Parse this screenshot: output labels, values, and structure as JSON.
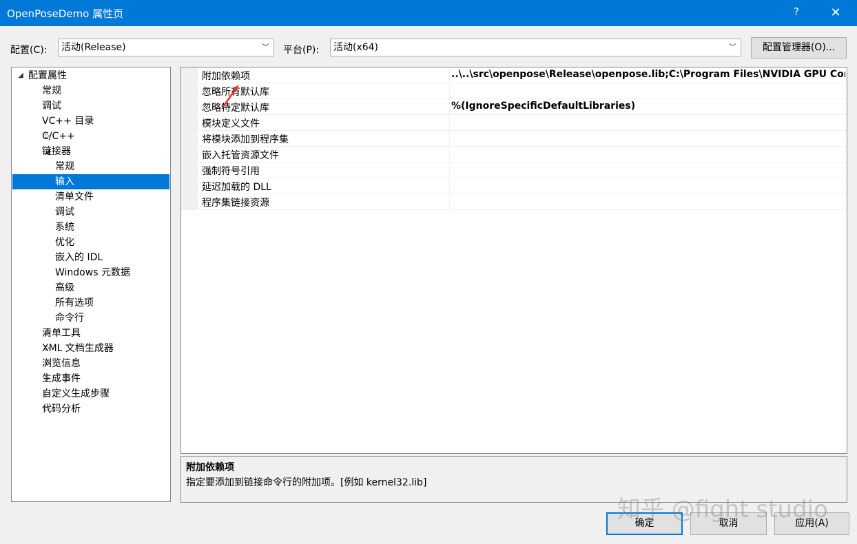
{
  "window": {
    "title": "OpenPoseDemo 属性页",
    "help_label": "?",
    "close_label": "✕"
  },
  "config_bar": {
    "config_label": "配置(C):",
    "config_value": "活动(Release)",
    "platform_label": "平台(P):",
    "platform_value": "活动(x64)",
    "manager_button": "配置管理器(O)..."
  },
  "tree": {
    "items": [
      {
        "label": "配置属性",
        "expander": "◢",
        "level": 0,
        "selected": false
      },
      {
        "label": "常规",
        "expander": "",
        "level": 1,
        "selected": false
      },
      {
        "label": "调试",
        "expander": "",
        "level": 1,
        "selected": false
      },
      {
        "label": "VC++ 目录",
        "expander": "",
        "level": 1,
        "selected": false
      },
      {
        "label": "C/C++",
        "expander": "▷",
        "level": 1,
        "selected": false
      },
      {
        "label": "链接器",
        "expander": "◢",
        "level": 1,
        "selected": false
      },
      {
        "label": "常规",
        "expander": "",
        "level": 2,
        "selected": false
      },
      {
        "label": "输入",
        "expander": "",
        "level": 2,
        "selected": true
      },
      {
        "label": "清单文件",
        "expander": "",
        "level": 2,
        "selected": false
      },
      {
        "label": "调试",
        "expander": "",
        "level": 2,
        "selected": false
      },
      {
        "label": "系统",
        "expander": "",
        "level": 2,
        "selected": false
      },
      {
        "label": "优化",
        "expander": "",
        "level": 2,
        "selected": false
      },
      {
        "label": "嵌入的 IDL",
        "expander": "",
        "level": 2,
        "selected": false
      },
      {
        "label": "Windows 元数据",
        "expander": "",
        "level": 2,
        "selected": false
      },
      {
        "label": "高级",
        "expander": "",
        "level": 2,
        "selected": false
      },
      {
        "label": "所有选项",
        "expander": "",
        "level": 2,
        "selected": false
      },
      {
        "label": "命令行",
        "expander": "",
        "level": 2,
        "selected": false
      },
      {
        "label": "清单工具",
        "expander": "▷",
        "level": 1,
        "selected": false
      },
      {
        "label": "XML 文档生成器",
        "expander": "▷",
        "level": 1,
        "selected": false
      },
      {
        "label": "浏览信息",
        "expander": "▷",
        "level": 1,
        "selected": false
      },
      {
        "label": "生成事件",
        "expander": "▷",
        "level": 1,
        "selected": false
      },
      {
        "label": "自定义生成步骤",
        "expander": "▷",
        "level": 1,
        "selected": false
      },
      {
        "label": "代码分析",
        "expander": "▷",
        "level": 1,
        "selected": false
      }
    ]
  },
  "properties": [
    {
      "name": "附加依赖项",
      "value": "..\\..\\src\\openpose\\Release\\openpose.lib;C:\\Program Files\\NVIDIA GPU Computing Toolkit"
    },
    {
      "name": "忽略所有默认库",
      "value": ""
    },
    {
      "name": "忽略特定默认库",
      "value": "%(IgnoreSpecificDefaultLibraries)"
    },
    {
      "name": "模块定义文件",
      "value": ""
    },
    {
      "name": "将模块添加到程序集",
      "value": ""
    },
    {
      "name": "嵌入托管资源文件",
      "value": ""
    },
    {
      "name": "强制符号引用",
      "value": ""
    },
    {
      "name": "延迟加载的 DLL",
      "value": ""
    },
    {
      "name": "程序集链接资源",
      "value": ""
    }
  ],
  "description": {
    "title": "附加依赖项",
    "text": "指定要添加到链接命令行的附加项。[例如 kernel32.lib]"
  },
  "buttons": {
    "ok": "确定",
    "cancel": "取消",
    "apply": "应用(A)"
  },
  "watermark": "知乎 @fight studio",
  "colors": {
    "accent": "#0078d7",
    "annotation_arrow": "#e8322d"
  }
}
